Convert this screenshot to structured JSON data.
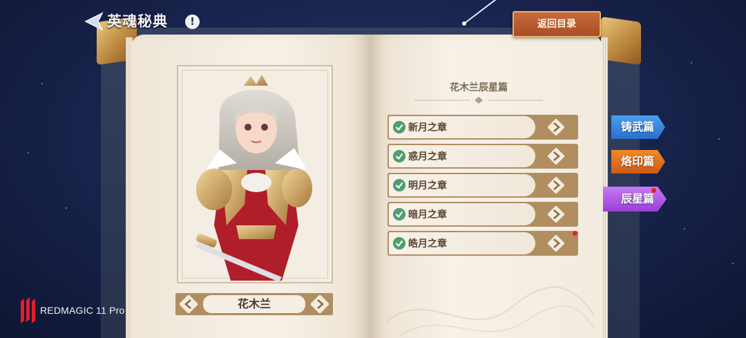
{
  "header": {
    "title": "英魂秘典",
    "info_icon": "!",
    "return_label": "返回目录"
  },
  "hero": {
    "name": "花木兰"
  },
  "chapters": {
    "section_title": "花木兰辰星篇",
    "items": [
      {
        "label": "新月之章",
        "completed": true,
        "has_notification": false
      },
      {
        "label": "惑月之章",
        "completed": true,
        "has_notification": false
      },
      {
        "label": "明月之章",
        "completed": true,
        "has_notification": false
      },
      {
        "label": "暗月之章",
        "completed": true,
        "has_notification": false
      },
      {
        "label": "皓月之章",
        "completed": true,
        "has_notification": true
      }
    ]
  },
  "side_tabs": [
    {
      "label": "铸武篇",
      "color": "#3a8be6",
      "has_notification": false
    },
    {
      "label": "烙印篇",
      "color": "#e6761e",
      "has_notification": false
    },
    {
      "label": "辰星篇",
      "color": "#b45ae8",
      "has_notification": true
    }
  ],
  "watermark": {
    "text": "REDMAGIC 11 Pro"
  },
  "colors": {
    "page_bg": "#f5efe5",
    "frame_gold": "#b08e60",
    "check_green": "#4f9f6f",
    "return_button": "#b85a2e",
    "notification_red": "#e62020"
  }
}
